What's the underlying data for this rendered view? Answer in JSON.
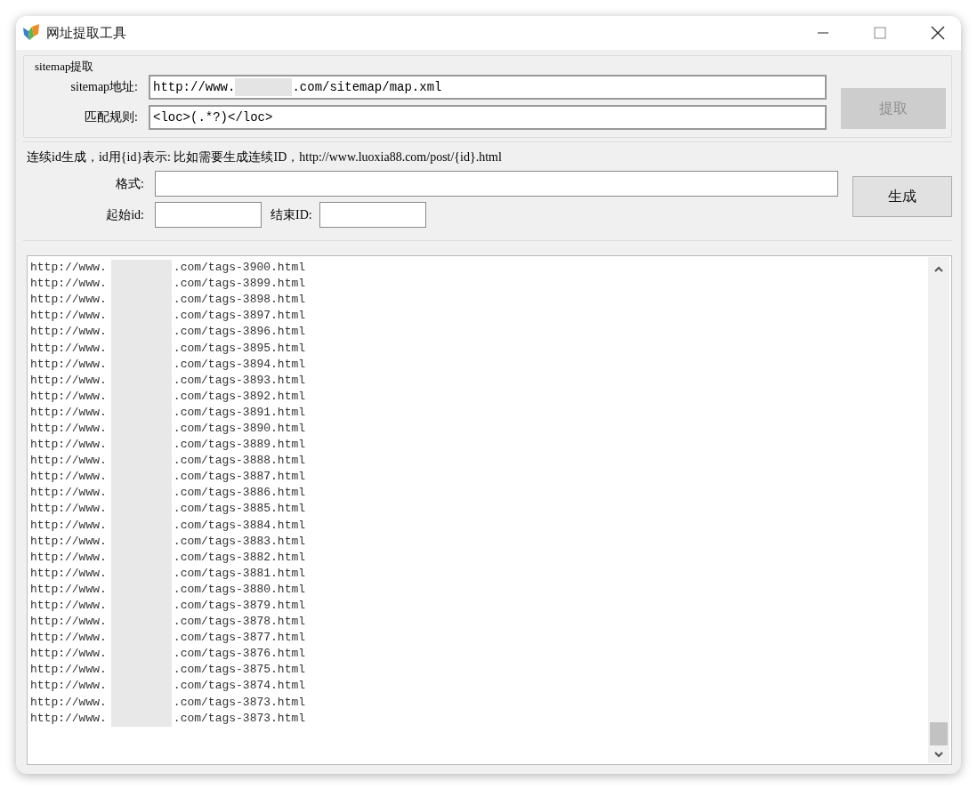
{
  "window": {
    "title": "网址提取工具"
  },
  "sitemap_group": {
    "title": "sitemap提取",
    "url": {
      "label": "sitemap地址:",
      "value_before": "http://www.",
      "value_after": ".com/sitemap/map.xml"
    },
    "rule": {
      "label": "匹配规则:",
      "value": "<loc>(.*?)</loc>"
    },
    "extract_button": {
      "label": "提取",
      "disabled": true
    }
  },
  "sequence": {
    "hint": "连续id生成，id用{id}表示: 比如需要生成连续ID，http://www.luoxia88.com/post/{id}.html",
    "format_label": "格式:",
    "start_label": "起始id:",
    "end_label": "结束ID:",
    "generate_button": {
      "label": "生成",
      "disabled": false
    }
  },
  "results": [
    {
      "before": "http://www.",
      "after": ".com/tags-3900.html"
    },
    {
      "before": "http://www.",
      "after": ".com/tags-3899.html"
    },
    {
      "before": "http://www.",
      "after": ".com/tags-3898.html"
    },
    {
      "before": "http://www.",
      "after": ".com/tags-3897.html"
    },
    {
      "before": "http://www.",
      "after": ".com/tags-3896.html"
    },
    {
      "before": "http://www.",
      "after": ".com/tags-3895.html"
    },
    {
      "before": "http://www.",
      "after": ".com/tags-3894.html"
    },
    {
      "before": "http://www.",
      "after": ".com/tags-3893.html"
    },
    {
      "before": "http://www.",
      "after": ".com/tags-3892.html"
    },
    {
      "before": "http://www.",
      "after": ".com/tags-3891.html"
    },
    {
      "before": "http://www.",
      "after": ".com/tags-3890.html"
    },
    {
      "before": "http://www.",
      "after": ".com/tags-3889.html"
    },
    {
      "before": "http://www.",
      "after": ".com/tags-3888.html"
    },
    {
      "before": "http://www.",
      "after": ".com/tags-3887.html"
    },
    {
      "before": "http://www.",
      "after": ".com/tags-3886.html"
    },
    {
      "before": "http://www.",
      "after": ".com/tags-3885.html"
    },
    {
      "before": "http://www.",
      "after": ".com/tags-3884.html"
    },
    {
      "before": "http://www.",
      "after": ".com/tags-3883.html"
    },
    {
      "before": "http://www.",
      "after": ".com/tags-3882.html"
    },
    {
      "before": "http://www.",
      "after": ".com/tags-3881.html"
    },
    {
      "before": "http://www.",
      "after": ".com/tags-3880.html"
    },
    {
      "before": "http://www.",
      "after": ".com/tags-3879.html"
    },
    {
      "before": "http://www.",
      "after": ".com/tags-3878.html"
    },
    {
      "before": "http://www.",
      "after": ".com/tags-3877.html"
    },
    {
      "before": "http://www.",
      "after": ".com/tags-3876.html"
    },
    {
      "before": "http://www.",
      "after": ".com/tags-3875.html"
    },
    {
      "before": "http://www.",
      "after": ".com/tags-3874.html"
    },
    {
      "before": "http://www.",
      "after": ".com/tags-3873.html"
    },
    {
      "before": "http://www.",
      "after": ".com/tags-3873.html"
    }
  ]
}
